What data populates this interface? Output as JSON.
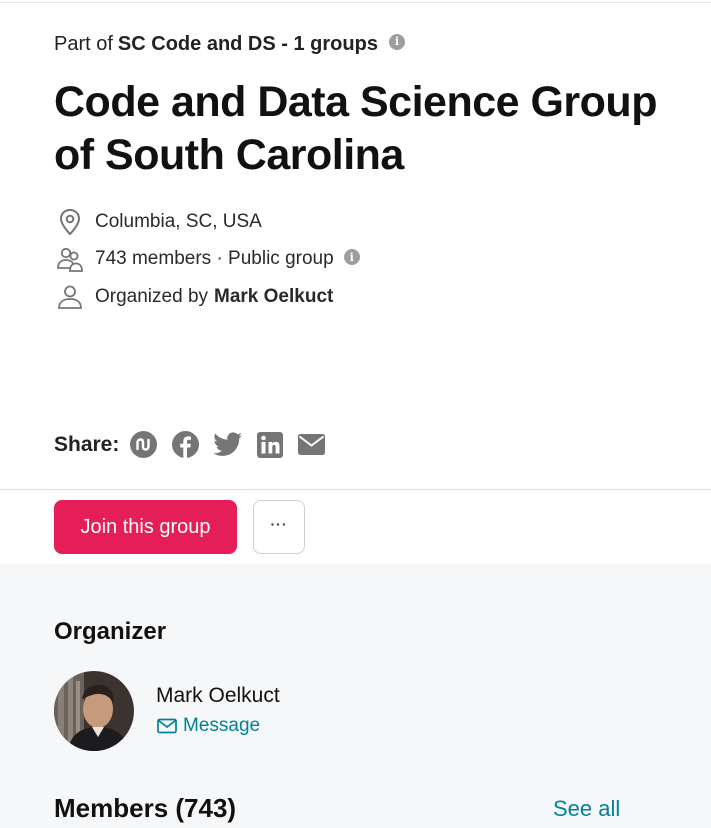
{
  "group": {
    "part_of_prefix": "Part of",
    "part_of_network": "SC Code and DS - 1 groups",
    "title": "Code and Data Science Group of South Carolina",
    "location": "Columbia, SC, USA",
    "members_line": "743 members · Public group",
    "organized_by_prefix": "Organized by",
    "organizer_name": "Mark Oelkuct",
    "info_glyph": "i"
  },
  "share": {
    "label": "Share:",
    "icons": [
      "meetup-icon",
      "facebook-icon",
      "twitter-icon",
      "linkedin-icon",
      "email-icon"
    ]
  },
  "actions": {
    "join_label": "Join this group",
    "more_label": "···"
  },
  "organizer_section": {
    "heading": "Organizer",
    "name": "Mark Oelkuct",
    "message_label": "Message"
  },
  "members_section": {
    "heading": "Members (743)",
    "see_all_label": "See all"
  },
  "colors": {
    "accent": "#e51e5a",
    "link": "#00829b",
    "icon_gray": "#757575",
    "section_bg": "#f6f7f8"
  }
}
